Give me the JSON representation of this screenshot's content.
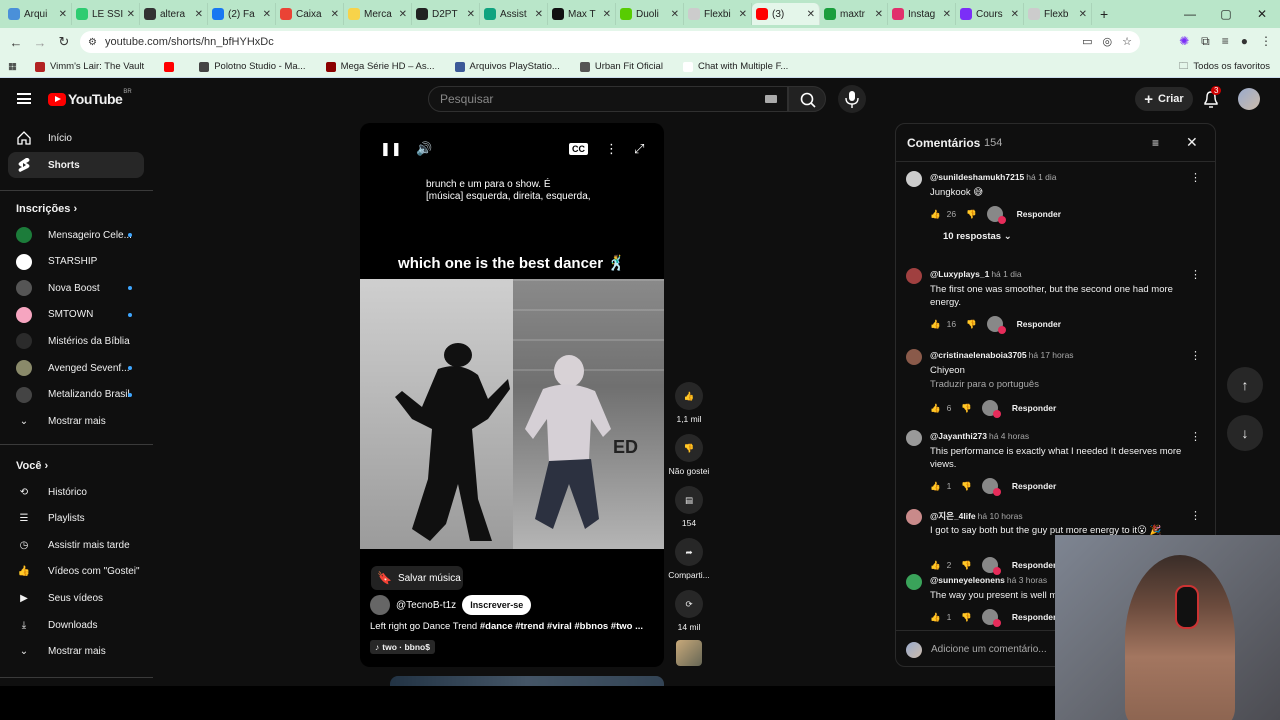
{
  "browser": {
    "tabs": [
      {
        "title": "Arqui",
        "color": "#4a90d9"
      },
      {
        "title": "LE SSI",
        "color": "#2ecc71"
      },
      {
        "title": "altera",
        "color": "#333333"
      },
      {
        "title": "(2) Fa",
        "color": "#1877f2"
      },
      {
        "title": "Caixa",
        "color": "#ea4335"
      },
      {
        "title": "Merca",
        "color": "#f7d34a"
      },
      {
        "title": "D2PT",
        "color": "#222222"
      },
      {
        "title": "Assist",
        "color": "#10a37f"
      },
      {
        "title": "Max T",
        "color": "#111111"
      },
      {
        "title": "Duoli",
        "color": "#58cc02"
      },
      {
        "title": "Flexbi",
        "color": "#cccccc"
      },
      {
        "title": "(3)",
        "color": "#ff0000"
      },
      {
        "title": "maxtr",
        "color": "#1a9e3c"
      },
      {
        "title": "Instag",
        "color": "#e1306c"
      },
      {
        "title": "Cours",
        "color": "#7b2ff7"
      },
      {
        "title": "Flexb",
        "color": "#cccccc"
      }
    ],
    "url": "youtube.com/shorts/hn_bfHYHxDc",
    "bookmarks": [
      {
        "label": "Vimm's Lair: The Vault",
        "color": "#b22222"
      },
      {
        "label": "",
        "color": "#ff0000"
      },
      {
        "label": "Polotno Studio - Ma...",
        "color": "#444444"
      },
      {
        "label": "Mega Série HD – As...",
        "color": "#8b0000"
      },
      {
        "label": "Arquivos PlayStatio...",
        "color": "#3b5998"
      },
      {
        "label": "Urban Fit Oficial",
        "color": "#555555"
      },
      {
        "label": "Chat with Multiple F...",
        "color": "#ffffff"
      }
    ],
    "all_bookmarks": "Todos os favoritos"
  },
  "header": {
    "logo": "YouTube",
    "region": "BR",
    "search_placeholder": "Pesquisar",
    "create_label": "Criar",
    "notifications_count": "3"
  },
  "sidebar": {
    "home": "Início",
    "shorts": "Shorts",
    "subscriptions_title": "Inscrições",
    "channels": [
      {
        "name": "Mensageiro Cele...",
        "color": "#1c7c3a",
        "new": true
      },
      {
        "name": "STARSHIP",
        "color": "#ffffff",
        "new": false
      },
      {
        "name": "Nova Boost",
        "color": "#555555",
        "new": true
      },
      {
        "name": "SMTOWN",
        "color": "#f6a5c0",
        "new": true
      },
      {
        "name": "Mistérios da Bíblia",
        "color": "#2b2b2b",
        "new": false
      },
      {
        "name": "Avenged Sevenf...",
        "color": "#8a8a6a",
        "new": true
      },
      {
        "name": "Metalizando Brasil",
        "color": "#444444",
        "new": true
      }
    ],
    "show_more": "Mostrar mais",
    "you_title": "Você",
    "you_items": [
      "Histórico",
      "Playlists",
      "Assistir mais tarde",
      "Vídeos com \"Gostei\"",
      "Seus vídeos",
      "Downloads"
    ],
    "show_more_2": "Mostrar mais"
  },
  "short": {
    "caption_line1": "brunch e um para o show.  É",
    "caption_line2": "[música] esquerda, direita, esquerda,",
    "overlay_title": "which one is the best dancer 🕺",
    "watermark": "ED",
    "save_music": "Salvar música",
    "channel": "@TecnoB-t1z",
    "subscribe": "Inscrever-se",
    "description": "Left right go Dance Trend",
    "hashtags": "#dance #trend #viral #bbnos #two ...",
    "music": "two · bbno$"
  },
  "actions": {
    "likes": "1,1 mil",
    "dislike": "Não gostei",
    "comments": "154",
    "share": "Comparti...",
    "remix": "14 mil"
  },
  "comments_panel": {
    "title": "Comentários",
    "count": "154",
    "add_placeholder": "Adicione um comentário...",
    "items": [
      {
        "author": "@sunildeshamukh7215",
        "time": "há 1 dia",
        "text": "Jungkook 😅",
        "likes": "26",
        "av": "#cccccc",
        "replies": "10 respostas"
      },
      {
        "author": "@Luxyplays_1",
        "time": "há 1 dia",
        "text": "The first one was smoother, but the second one had more energy.",
        "likes": "16",
        "av": "#a04040"
      },
      {
        "author": "@cristinaelenaboia3705",
        "time": "há 17 horas",
        "text": "Chiyeon",
        "translate": "Traduzir para o português",
        "likes": "6",
        "av": "#8a5a4a"
      },
      {
        "author": "@Jayanthi273",
        "time": "há 4 horas",
        "text": "This performance is exactly what I needed It deserves more views.",
        "likes": "1",
        "av": "#999999"
      },
      {
        "author": "@지은_4life",
        "time": "há 10 horas",
        "text": "I got to say both but the guy put more energy to it😮 🎉",
        "likes": "2",
        "av": "#c98a8a"
      },
      {
        "author": "@sunneyeleonens",
        "time": "há 3 horas",
        "text": "The way you present is well m",
        "likes": "1",
        "av": "#3aa35a"
      }
    ],
    "reply_label": "Responder"
  }
}
